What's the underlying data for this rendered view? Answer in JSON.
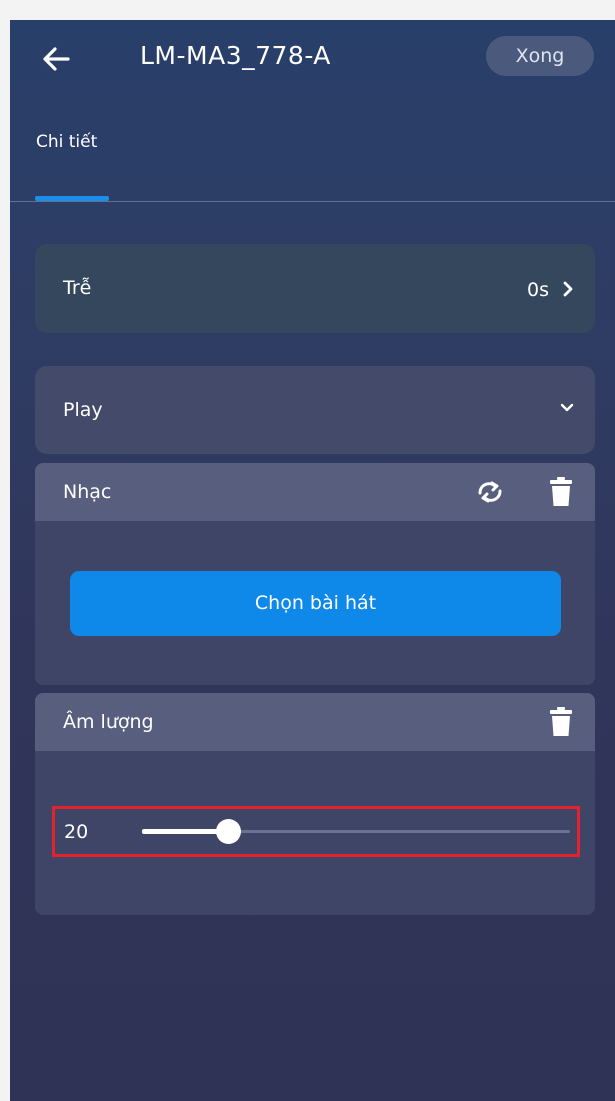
{
  "header": {
    "title": "LM-MA3_778-A",
    "done_label": "Xong",
    "back_icon": "arrow-left-icon"
  },
  "tabs": [
    {
      "label": "Chi tiết",
      "active": true
    }
  ],
  "delay": {
    "label": "Trễ",
    "value": "0s",
    "chevron_icon": "chevron-right-icon"
  },
  "action": {
    "selected": "Play",
    "chevron_icon": "chevron-down-icon"
  },
  "music": {
    "title": "Nhạc",
    "refresh_icon": "refresh-icon",
    "delete_icon": "trash-icon",
    "choose_song_label": "Chọn bài hát"
  },
  "volume": {
    "title": "Âm lượng",
    "delete_icon": "trash-icon",
    "value": "20",
    "level_fraction": 0.2
  },
  "colors": {
    "accent": "#0e88e9",
    "highlight_border": "#e3222e",
    "tab_indicator": "#1a8ee8"
  }
}
